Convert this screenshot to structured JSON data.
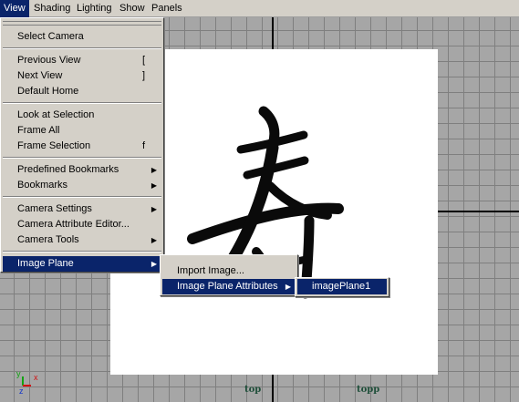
{
  "menubar": [
    "View",
    "Shading",
    "Lighting",
    "Show",
    "Panels"
  ],
  "view_menu": [
    {
      "label": "Select Camera"
    },
    {
      "label": "Previous View",
      "shortcut": "["
    },
    {
      "label": "Next View",
      "shortcut": "]"
    },
    {
      "label": "Default Home"
    },
    {
      "label": "Look at Selection"
    },
    {
      "label": "Frame All"
    },
    {
      "label": "Frame Selection",
      "shortcut": "f"
    },
    {
      "label": "Predefined Bookmarks"
    },
    {
      "label": "Bookmarks"
    },
    {
      "label": "Camera Settings"
    },
    {
      "label": "Camera Attribute Editor..."
    },
    {
      "label": "Camera Tools"
    },
    {
      "label": "Image Plane"
    }
  ],
  "image_plane_menu": [
    "Import Image...",
    "Image Plane Attributes"
  ],
  "attributes_menu": [
    "imagePlane1"
  ],
  "viewport": {
    "camera_label": "top",
    "camera_label_right": "topp"
  },
  "axis_indicator": {
    "x": "x",
    "y": "y",
    "z": "z"
  },
  "colors": {
    "menu_bg": "#d4d0c8",
    "highlight": "#0a246a",
    "grid_bg": "#a6a6a6"
  },
  "icons": {
    "submenu": "right-triangle"
  }
}
